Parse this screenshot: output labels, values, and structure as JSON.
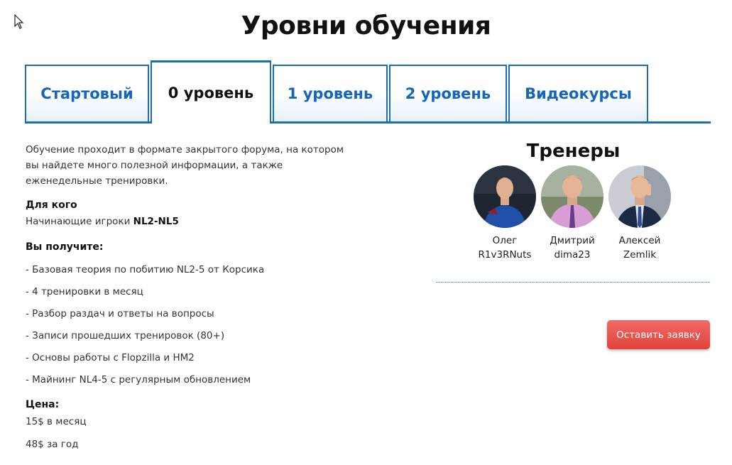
{
  "page": {
    "title": "Уровни обучения"
  },
  "tabs": [
    {
      "label": "Стартовый",
      "active": false
    },
    {
      "label": "0 уровень",
      "active": true
    },
    {
      "label": "1 уровень",
      "active": false
    },
    {
      "label": "2 уровень",
      "active": false
    },
    {
      "label": "Видеокурсы",
      "active": false
    }
  ],
  "content": {
    "intro": "Обучение проходит в формате закрытого форума, на котором вы найдете много полезной информации, а также еженедельные тренировки.",
    "for_whom_heading": "Для кого",
    "for_whom_text": "Начинающие игроки ",
    "for_whom_levels": "NL2-NL5",
    "you_get_heading": "Вы получите:",
    "benefits": [
      "- Базовая теория по побитию NL2-5 от Корсика",
      "- 4 тренировки в месяц",
      "- Разбор раздач и ответы на вопросы",
      "- Записи прошедших тренировок (80+)",
      "- Основы работы с Flopzilla и HM2",
      "- Майнинг NL4-5 с регулярным обновлением"
    ],
    "price_heading": "Цена:",
    "price_month": "15$ в месяц",
    "price_year": "48$ за год"
  },
  "trainers": {
    "title": "Тренеры",
    "items": [
      {
        "first_name": "Олег",
        "nick": "R1v3RNuts"
      },
      {
        "first_name": "Дмитрий",
        "nick": "dima23"
      },
      {
        "first_name": "Алексей",
        "nick": "Zemlik"
      }
    ]
  },
  "cta": {
    "label": "Оставить заявку"
  },
  "colors": {
    "tab_blue": "#1565b8",
    "border_blue": "#1a6fb5",
    "cta_red": "#e0433c"
  }
}
